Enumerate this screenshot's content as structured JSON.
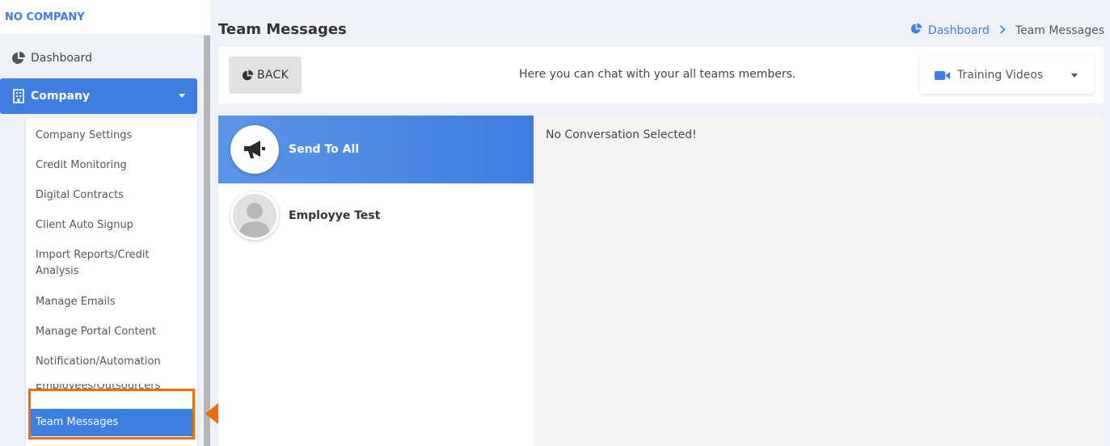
{
  "sidebar": {
    "brand": "NO COMPANY",
    "dashboard_label": "Dashboard",
    "company_label": "Company",
    "submenu": [
      "Company Settings",
      "Credit Monitoring",
      "Digital Contracts",
      "Client Auto Signup",
      "Import Reports/Credit Analysis",
      "Manage Emails",
      "Manage Portal Content",
      "Notification/Automation",
      "Employees/Outsourcers",
      "Team Messages"
    ]
  },
  "header": {
    "title": "Team Messages",
    "breadcrumb_home": "Dashboard",
    "breadcrumb_current": "Team Messages"
  },
  "toolbar": {
    "back_label": "BACK",
    "description": "Here you can chat with your all teams members.",
    "videos_label": "Training Videos"
  },
  "chats": [
    {
      "name": "Send To All",
      "icon": "megaphone-icon"
    },
    {
      "name": "Employye Test",
      "icon": "default-avatar-icon"
    }
  ],
  "conversation": {
    "empty_text": "No Conversation Selected!"
  },
  "colors": {
    "accent": "#3d7fe0",
    "highlight": "#f26b00"
  }
}
